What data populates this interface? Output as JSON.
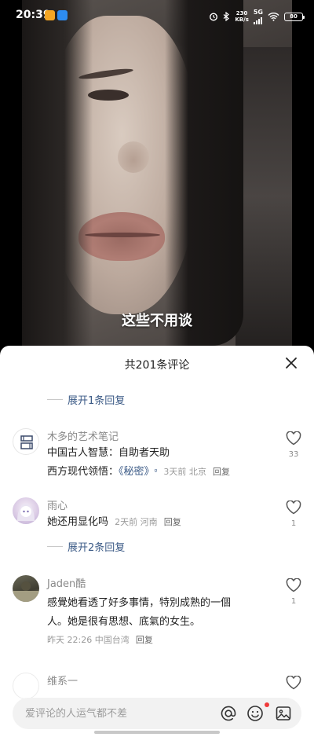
{
  "status_bar": {
    "time": "20:39",
    "net_speed_top": "230",
    "net_speed_bottom": "KB/s",
    "network": "5G",
    "battery": "80"
  },
  "video": {
    "subtitle": "这些不用谈"
  },
  "comments_sheet": {
    "title": "共201条评论",
    "top_expand": "展开1条回复",
    "comments": [
      {
        "user": "木多的艺术笔记",
        "line1": "中国古人智慧：自助者天助",
        "line2_prefix": "西方现代领悟：",
        "line2_link": "《秘密》",
        "meta": "3天前 北京",
        "reply": "回复",
        "likes": "33"
      },
      {
        "user": "雨心",
        "text": "她还用显化吗",
        "meta": "2天前 河南",
        "reply": "回复",
        "likes": "1",
        "expand": "展开2条回复"
      },
      {
        "user": "Jaden酷",
        "line1": "感覺她看透了好多事情，特別成熟的一個",
        "line2": "人。她是很有思想、底氣的女生。",
        "meta": "昨天 22:26 中国台湾",
        "reply": "回复",
        "likes": "1"
      },
      {
        "user": "维系一"
      }
    ]
  },
  "input": {
    "placeholder": "爱评论的人运气都不差"
  },
  "colors": {
    "accent_link": "#3b5a86",
    "notification_dot": "#f03a3a"
  }
}
